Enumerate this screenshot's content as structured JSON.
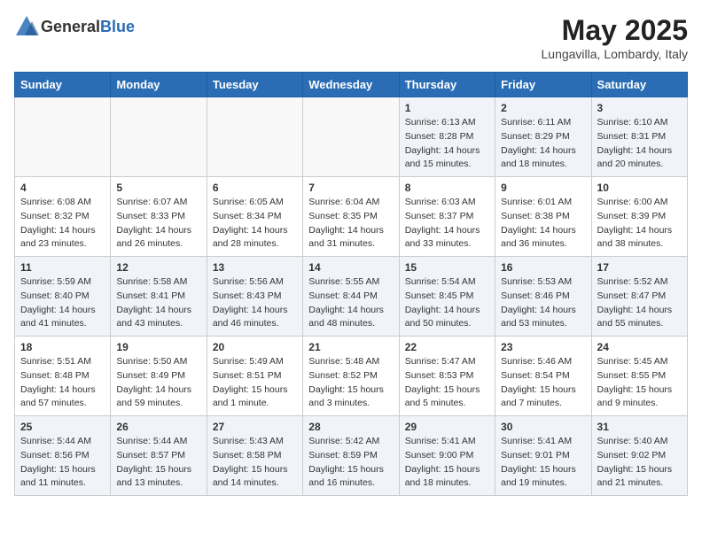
{
  "header": {
    "logo_general": "General",
    "logo_blue": "Blue",
    "month_year": "May 2025",
    "location": "Lungavilla, Lombardy, Italy"
  },
  "days_of_week": [
    "Sunday",
    "Monday",
    "Tuesday",
    "Wednesday",
    "Thursday",
    "Friday",
    "Saturday"
  ],
  "weeks": [
    [
      {
        "day": "",
        "info": ""
      },
      {
        "day": "",
        "info": ""
      },
      {
        "day": "",
        "info": ""
      },
      {
        "day": "",
        "info": ""
      },
      {
        "day": "1",
        "info": "Sunrise: 6:13 AM\nSunset: 8:28 PM\nDaylight: 14 hours\nand 15 minutes."
      },
      {
        "day": "2",
        "info": "Sunrise: 6:11 AM\nSunset: 8:29 PM\nDaylight: 14 hours\nand 18 minutes."
      },
      {
        "day": "3",
        "info": "Sunrise: 6:10 AM\nSunset: 8:31 PM\nDaylight: 14 hours\nand 20 minutes."
      }
    ],
    [
      {
        "day": "4",
        "info": "Sunrise: 6:08 AM\nSunset: 8:32 PM\nDaylight: 14 hours\nand 23 minutes."
      },
      {
        "day": "5",
        "info": "Sunrise: 6:07 AM\nSunset: 8:33 PM\nDaylight: 14 hours\nand 26 minutes."
      },
      {
        "day": "6",
        "info": "Sunrise: 6:05 AM\nSunset: 8:34 PM\nDaylight: 14 hours\nand 28 minutes."
      },
      {
        "day": "7",
        "info": "Sunrise: 6:04 AM\nSunset: 8:35 PM\nDaylight: 14 hours\nand 31 minutes."
      },
      {
        "day": "8",
        "info": "Sunrise: 6:03 AM\nSunset: 8:37 PM\nDaylight: 14 hours\nand 33 minutes."
      },
      {
        "day": "9",
        "info": "Sunrise: 6:01 AM\nSunset: 8:38 PM\nDaylight: 14 hours\nand 36 minutes."
      },
      {
        "day": "10",
        "info": "Sunrise: 6:00 AM\nSunset: 8:39 PM\nDaylight: 14 hours\nand 38 minutes."
      }
    ],
    [
      {
        "day": "11",
        "info": "Sunrise: 5:59 AM\nSunset: 8:40 PM\nDaylight: 14 hours\nand 41 minutes."
      },
      {
        "day": "12",
        "info": "Sunrise: 5:58 AM\nSunset: 8:41 PM\nDaylight: 14 hours\nand 43 minutes."
      },
      {
        "day": "13",
        "info": "Sunrise: 5:56 AM\nSunset: 8:43 PM\nDaylight: 14 hours\nand 46 minutes."
      },
      {
        "day": "14",
        "info": "Sunrise: 5:55 AM\nSunset: 8:44 PM\nDaylight: 14 hours\nand 48 minutes."
      },
      {
        "day": "15",
        "info": "Sunrise: 5:54 AM\nSunset: 8:45 PM\nDaylight: 14 hours\nand 50 minutes."
      },
      {
        "day": "16",
        "info": "Sunrise: 5:53 AM\nSunset: 8:46 PM\nDaylight: 14 hours\nand 53 minutes."
      },
      {
        "day": "17",
        "info": "Sunrise: 5:52 AM\nSunset: 8:47 PM\nDaylight: 14 hours\nand 55 minutes."
      }
    ],
    [
      {
        "day": "18",
        "info": "Sunrise: 5:51 AM\nSunset: 8:48 PM\nDaylight: 14 hours\nand 57 minutes."
      },
      {
        "day": "19",
        "info": "Sunrise: 5:50 AM\nSunset: 8:49 PM\nDaylight: 14 hours\nand 59 minutes."
      },
      {
        "day": "20",
        "info": "Sunrise: 5:49 AM\nSunset: 8:51 PM\nDaylight: 15 hours\nand 1 minute."
      },
      {
        "day": "21",
        "info": "Sunrise: 5:48 AM\nSunset: 8:52 PM\nDaylight: 15 hours\nand 3 minutes."
      },
      {
        "day": "22",
        "info": "Sunrise: 5:47 AM\nSunset: 8:53 PM\nDaylight: 15 hours\nand 5 minutes."
      },
      {
        "day": "23",
        "info": "Sunrise: 5:46 AM\nSunset: 8:54 PM\nDaylight: 15 hours\nand 7 minutes."
      },
      {
        "day": "24",
        "info": "Sunrise: 5:45 AM\nSunset: 8:55 PM\nDaylight: 15 hours\nand 9 minutes."
      }
    ],
    [
      {
        "day": "25",
        "info": "Sunrise: 5:44 AM\nSunset: 8:56 PM\nDaylight: 15 hours\nand 11 minutes."
      },
      {
        "day": "26",
        "info": "Sunrise: 5:44 AM\nSunset: 8:57 PM\nDaylight: 15 hours\nand 13 minutes."
      },
      {
        "day": "27",
        "info": "Sunrise: 5:43 AM\nSunset: 8:58 PM\nDaylight: 15 hours\nand 14 minutes."
      },
      {
        "day": "28",
        "info": "Sunrise: 5:42 AM\nSunset: 8:59 PM\nDaylight: 15 hours\nand 16 minutes."
      },
      {
        "day": "29",
        "info": "Sunrise: 5:41 AM\nSunset: 9:00 PM\nDaylight: 15 hours\nand 18 minutes."
      },
      {
        "day": "30",
        "info": "Sunrise: 5:41 AM\nSunset: 9:01 PM\nDaylight: 15 hours\nand 19 minutes."
      },
      {
        "day": "31",
        "info": "Sunrise: 5:40 AM\nSunset: 9:02 PM\nDaylight: 15 hours\nand 21 minutes."
      }
    ]
  ]
}
